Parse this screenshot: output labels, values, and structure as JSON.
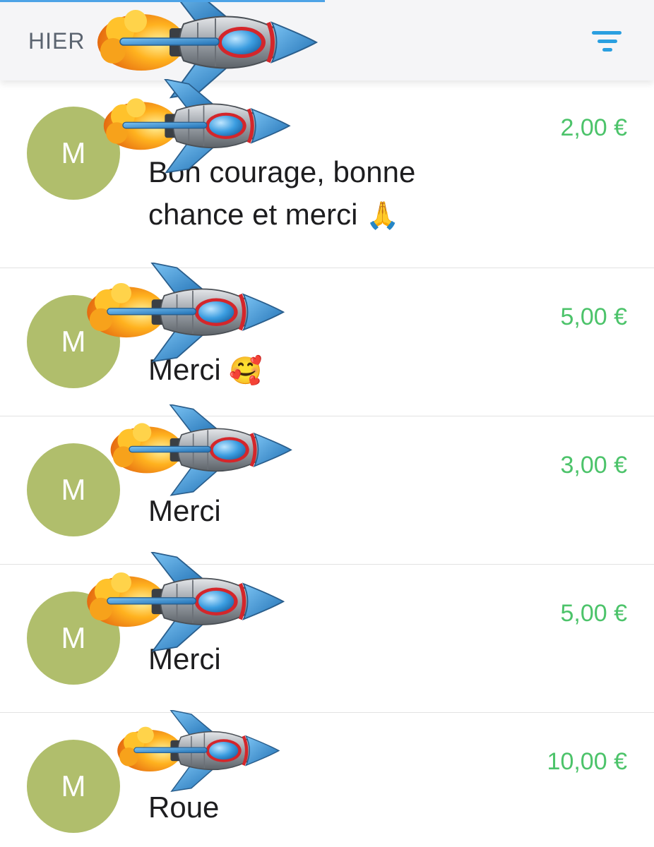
{
  "header": {
    "title": "HIER",
    "filter_icon": "filter-icon"
  },
  "colors": {
    "amount": "#4cc36a",
    "avatar": "#b0be6c",
    "accent": "#2a9fe0"
  },
  "transactions": [
    {
      "avatar": "M",
      "amount": "2,00 €",
      "message": "Bon courage, bonne chance et merci",
      "emoji": "🙏",
      "emoji_name": "folded-hands-emoji"
    },
    {
      "avatar": "M",
      "amount": "5,00 €",
      "message": "Merci",
      "emoji": "🥰",
      "emoji_name": "smiling-face-hearts-emoji"
    },
    {
      "avatar": "M",
      "amount": "3,00 €",
      "message": "Merci",
      "emoji": "",
      "emoji_name": ""
    },
    {
      "avatar": "M",
      "amount": "5,00 €",
      "message": "Merci",
      "emoji": "",
      "emoji_name": ""
    },
    {
      "avatar": "M",
      "amount": "10,00 €",
      "message": "Roue",
      "emoji": "",
      "emoji_name": ""
    }
  ],
  "overlay": {
    "icon": "rocket-emoji"
  }
}
